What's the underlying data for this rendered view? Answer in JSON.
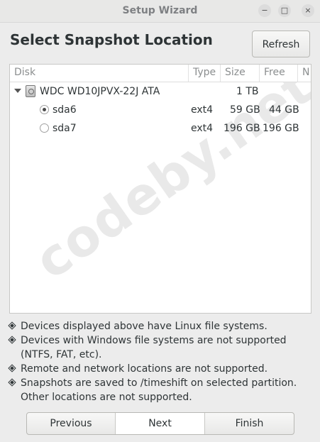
{
  "window": {
    "title": "Setup Wizard",
    "controls": {
      "minimize": "−",
      "maximize": "□",
      "close": "×"
    }
  },
  "page": {
    "heading": "Select Snapshot Location"
  },
  "toolbar": {
    "refresh_label": "Refresh"
  },
  "table": {
    "headers": [
      "Disk",
      "Type",
      "Size",
      "Free",
      "N"
    ],
    "disk": {
      "name": "WDC WD10JPVX-22J ATA",
      "size": "1 TB"
    },
    "partitions": [
      {
        "name": "sda6",
        "type": "ext4",
        "size": "59 GB",
        "free": "44 GB",
        "selected": true
      },
      {
        "name": "sda7",
        "type": "ext4",
        "size": "196 GB",
        "free": "196 GB",
        "selected": false
      }
    ]
  },
  "watermark": "codeby.net",
  "notes": [
    "Devices displayed above have Linux file systems.",
    "Devices with Windows file systems are not supported (NTFS, FAT, etc).",
    "Remote and network locations are not supported.",
    "Snapshots are saved to /timeshift on selected partition. Other locations are not supported."
  ],
  "navigation": {
    "previous_label": "Previous",
    "next_label": "Next",
    "finish_label": "Finish"
  }
}
